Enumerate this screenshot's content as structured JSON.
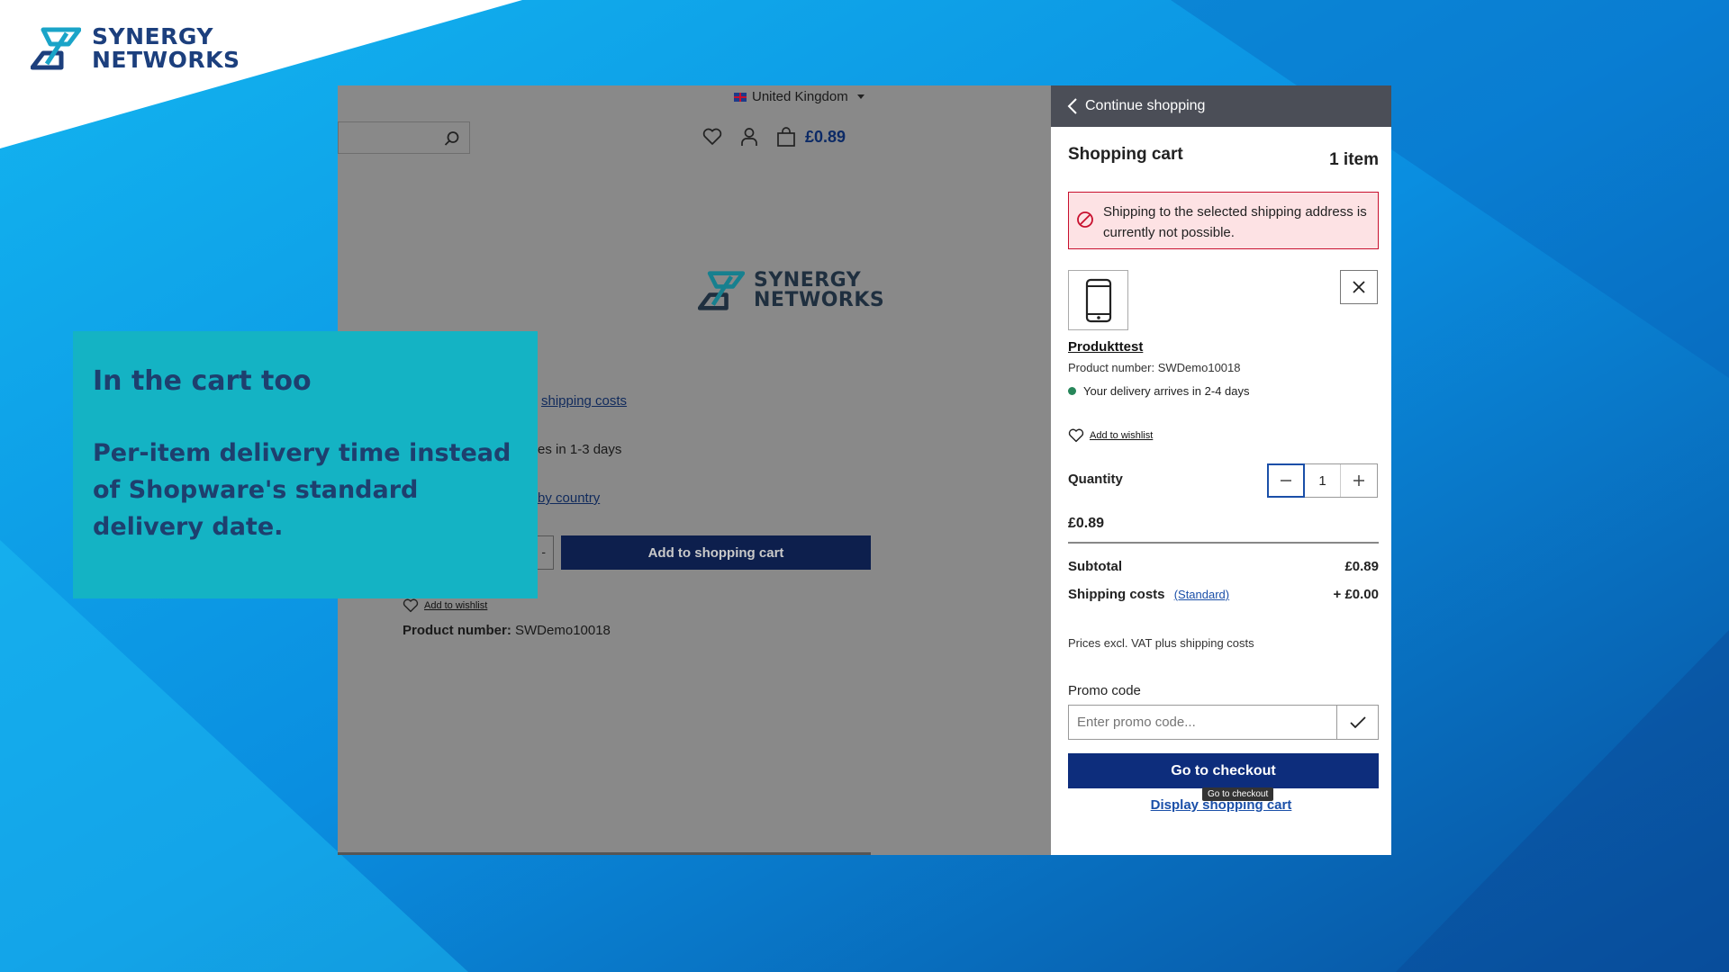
{
  "brand": {
    "logo_line1": "SYNERGY",
    "logo_line2": "NETWORKS",
    "colors": {
      "teal": "#14b3c4",
      "navy": "#1e3f6e",
      "blue_bg": "#0a8ee0"
    }
  },
  "overlay": {
    "title": "In the cart too",
    "body": "Per-item delivery time instead of Shopware's standard delivery date."
  },
  "shop": {
    "country": "United Kingdom",
    "cart_total": "£0.89",
    "link_shipping_costs": "shipping costs",
    "delivery_text": "es in 1-3 days",
    "link_by_country": "by country",
    "qty_stub_value": "-",
    "add_to_cart": "Add to shopping cart",
    "add_to_wishlist": "Add to wishlist",
    "product_number_label": "Product number:",
    "product_number": "SWDemo10018",
    "icons": [
      "search-icon",
      "heart-icon",
      "user-icon",
      "bag-icon"
    ]
  },
  "cart": {
    "continue_shopping": "Continue shopping",
    "title": "Shopping cart",
    "count": "1 item",
    "alert": "Shipping to the selected shipping address is currently not possible.",
    "product_name": "Produkttest",
    "product_number": "Product number: SWDemo10018",
    "delivery": "Your delivery arrives in 2-4 days",
    "add_to_wishlist": "Add to wishlist",
    "quantity_label": "Quantity",
    "quantity": "1",
    "price": "£0.89",
    "subtotal_label": "Subtotal",
    "subtotal": "£0.89",
    "shipping_label": "Shipping costs",
    "shipping_method": "(Standard)",
    "shipping_value": "+ £0.00",
    "vat_note": "Prices excl. VAT plus shipping costs",
    "promo_label": "Promo code",
    "promo_placeholder": "Enter promo code...",
    "checkout": "Go to checkout",
    "tooltip": "Go to checkout",
    "display_cart": "Display shopping cart",
    "icons": [
      "chevron-left-icon",
      "ban-icon",
      "phone-icon",
      "close-icon",
      "heart-icon",
      "minus-icon",
      "plus-icon",
      "check-icon"
    ]
  }
}
